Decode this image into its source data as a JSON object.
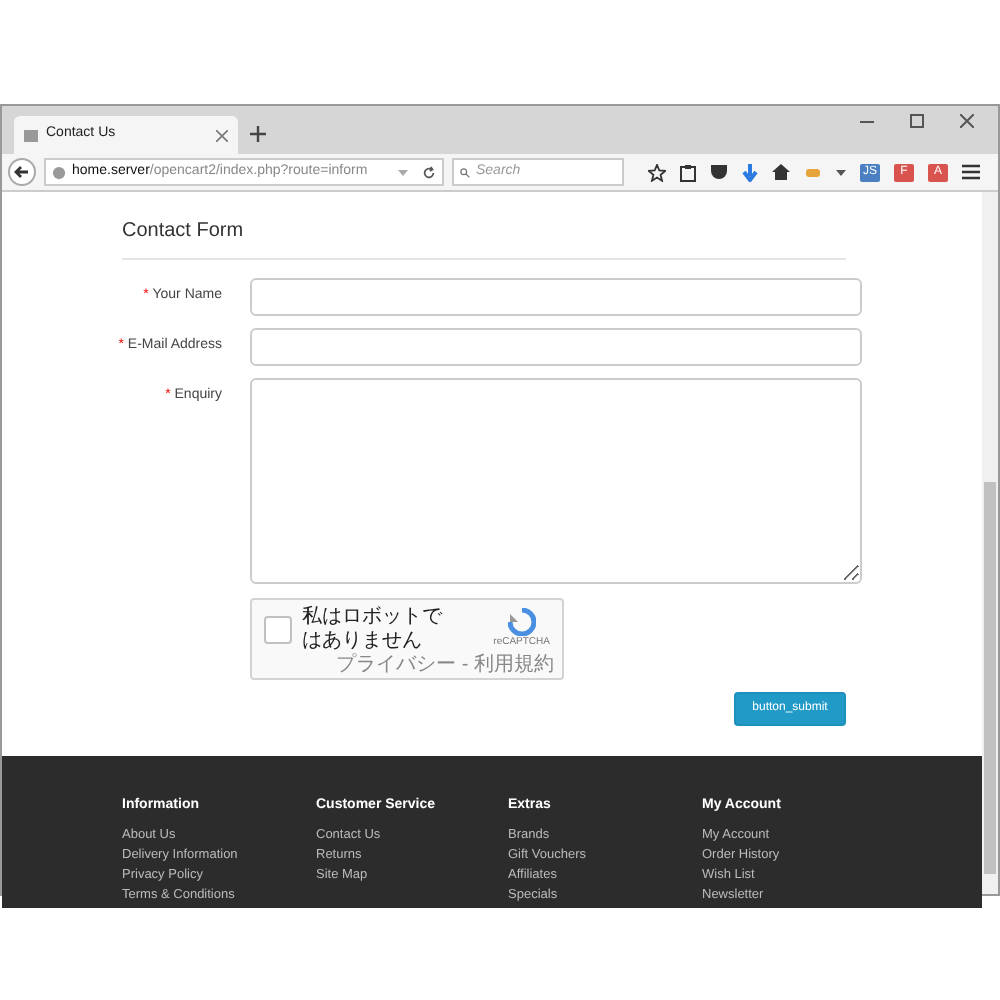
{
  "browser": {
    "tab_title": "Contact Us",
    "url_host": "home.server",
    "url_path": "/opencart2/index.php?route=inform",
    "search_placeholder": "Search",
    "badges": [
      {
        "label": "JS",
        "color": "#4a7fc1"
      },
      {
        "label": "F",
        "color": "#d9534f"
      },
      {
        "label": "A",
        "color": "#d9534f"
      }
    ]
  },
  "form": {
    "title": "Contact Form",
    "required_mark": "*",
    "fields": [
      {
        "label": "Your Name",
        "required": true,
        "kind": "input"
      },
      {
        "label": "E-Mail Address",
        "required": true,
        "kind": "input"
      },
      {
        "label": "Enquiry",
        "required": true,
        "kind": "textarea"
      }
    ],
    "captcha": {
      "text": "私はロボットではありません",
      "checked": false,
      "brand": "reCAPTCHA",
      "links": "プライバシー - 利用規約"
    },
    "submit": "button_submit"
  },
  "footer": {
    "columns": [
      {
        "title": "Information",
        "links": [
          "About Us",
          "Delivery Information",
          "Privacy Policy",
          "Terms & Conditions"
        ]
      },
      {
        "title": "Customer Service",
        "links": [
          "Contact Us",
          "Returns",
          "Site Map"
        ]
      },
      {
        "title": "Extras",
        "links": [
          "Brands",
          "Gift Vouchers",
          "Affiliates",
          "Specials"
        ]
      },
      {
        "title": "My Account",
        "links": [
          "My Account",
          "Order History",
          "Wish List",
          "Newsletter"
        ]
      }
    ]
  }
}
